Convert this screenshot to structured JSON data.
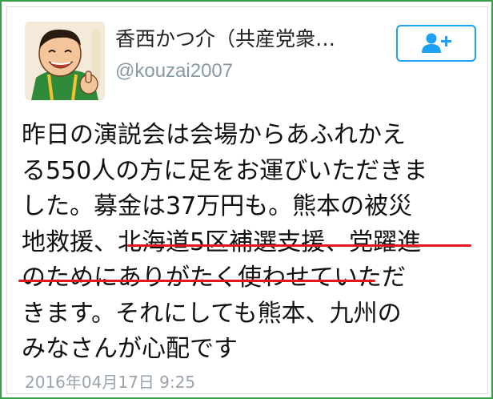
{
  "author": {
    "display_name": "香西かつ介（共産党衆…",
    "handle": "@kouzai2007"
  },
  "follow_button": {
    "icon": "add-user-icon",
    "accent_color": "#1da1f2"
  },
  "tweet": {
    "lines": [
      "昨日の演説会は会場からあふれかえ",
      "る550人の方に足をお運びいただきま",
      "した。募金は37万円も。熊本の被災",
      "地救援、北海道5区補選支援、党躍進",
      "のためにありがたく使わせていただ",
      "きます。それにしても熊本、九州の",
      "みなさんが心配です"
    ],
    "timestamp": "2016年04月17日 9:25"
  },
  "annotations": {
    "underline_color": "#e0191e",
    "frame_color": "#3aa047"
  }
}
